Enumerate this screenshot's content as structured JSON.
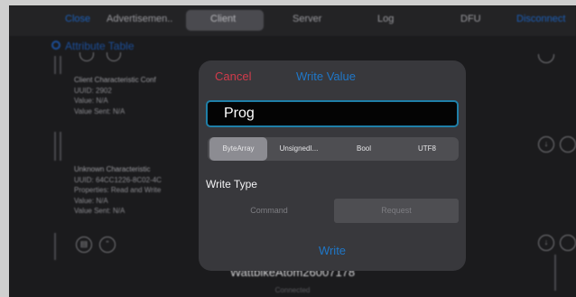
{
  "tabs": {
    "close": "Close",
    "advertisement": "Advertisemen..",
    "client": "Client",
    "server": "Server",
    "log": "Log",
    "dfu": "DFU",
    "disconnect": "Disconnect"
  },
  "attribute_table": {
    "title": "Attribute Table"
  },
  "cards": [
    {
      "name": "Client Characteristic Conf",
      "uuid": "UUID: 2902",
      "value": "Value: N/A",
      "value_sent": "Value Sent: N/A"
    },
    {
      "name": "Unknown Characteristic",
      "uuid": "UUID: 64CC1226-8C02-4C",
      "properties": "Properties: Read and Write",
      "value": "Value: N/A",
      "value_sent": "Value Sent: N/A"
    }
  ],
  "modal": {
    "cancel": "Cancel",
    "title": "Write Value",
    "input_value": "Prog",
    "formats": [
      "ByteArray",
      "UnsignedI...",
      "Bool",
      "UTF8"
    ],
    "selected_format": "ByteArray",
    "write_type_label": "Write Type",
    "write_types": [
      "Command",
      "Request"
    ],
    "selected_write_type": "Request",
    "write_button": "Write"
  },
  "device": {
    "name": "WattbikeAtom26007178",
    "status": "Connected"
  },
  "colors": {
    "accent": "#1f77c8",
    "cancel": "#d23b4b",
    "input_border": "#1f7fa8"
  }
}
